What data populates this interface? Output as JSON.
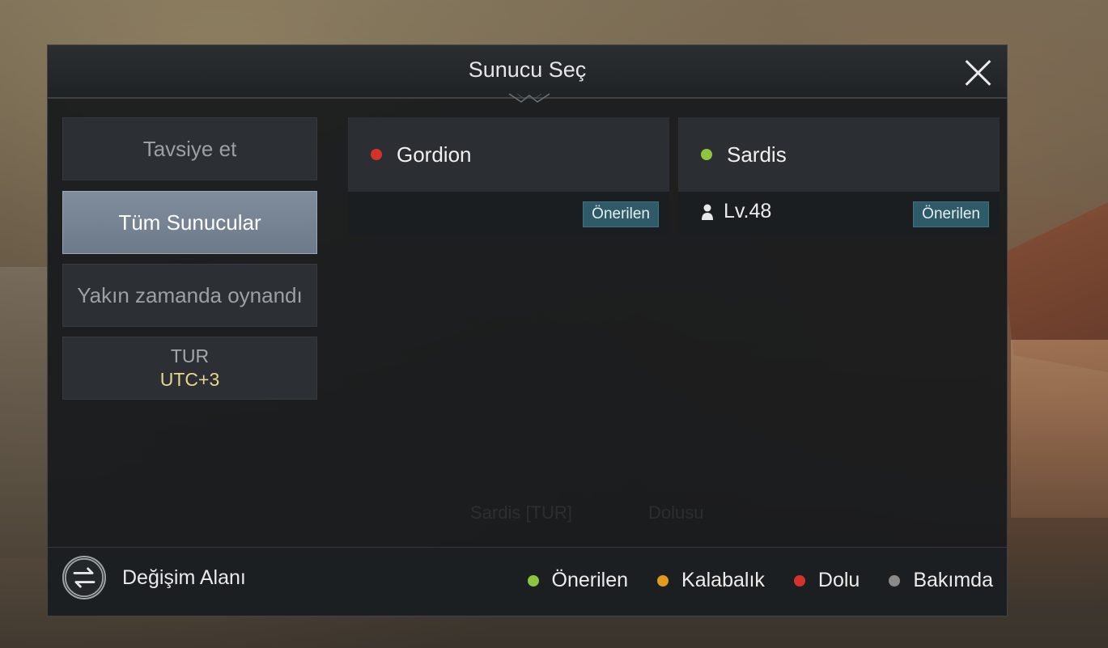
{
  "dialog": {
    "title": "Sunucu Seç",
    "close_icon": "close-icon"
  },
  "sidebar": {
    "items": [
      {
        "label": "Tavsiye et",
        "active": false
      },
      {
        "label": "Tüm Sunucular",
        "active": true
      },
      {
        "label": "Yakın zamanda oynandı",
        "active": false
      },
      {
        "label": "TUR",
        "sub": "UTC+3",
        "active": false
      }
    ]
  },
  "servers": [
    {
      "name": "Gordion",
      "status": "Dolu",
      "status_color": "#d6322c",
      "badge": "Önerilen"
    },
    {
      "name": "Sardis",
      "status": "Önerilen",
      "status_color": "#8cc63f",
      "level": "Lv.48",
      "badge": "Önerilen",
      "level_icon": "player-icon"
    }
  ],
  "footer": {
    "exchange_label": "Değişim Alanı",
    "exchange_icon": "swap-arrows-icon",
    "legend": [
      {
        "label": "Önerilen",
        "color": "#8cc63f"
      },
      {
        "label": "Kalabalık",
        "color": "#e09a1e"
      },
      {
        "label": "Dolu",
        "color": "#d6322c"
      },
      {
        "label": "Bakımda",
        "color": "#8a8a8a"
      }
    ]
  },
  "background_text": {
    "left": "Sardis [TUR]",
    "right": "Dolusu"
  }
}
